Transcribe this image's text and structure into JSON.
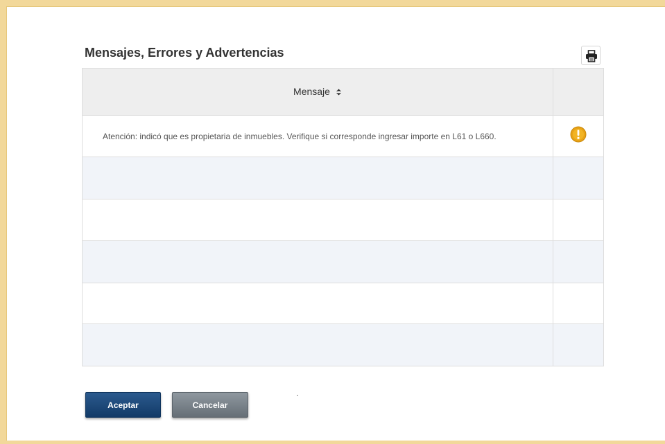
{
  "dialog": {
    "title": "Mensajes, Errores y Advertencias",
    "print_icon": "printer-icon"
  },
  "table": {
    "columns": [
      {
        "label": "Mensaje",
        "sort_icon": "sort-toggle-icon"
      },
      {
        "label": ""
      }
    ],
    "rows": [
      {
        "message": "Atención: indicó que es propietaria de inmuebles. Verifique si corresponde ingresar importe en L61 o L660.",
        "status_icon": "warning-icon"
      },
      {
        "message": "",
        "status_icon": ""
      },
      {
        "message": "",
        "status_icon": ""
      },
      {
        "message": "",
        "status_icon": ""
      },
      {
        "message": "",
        "status_icon": ""
      },
      {
        "message": "",
        "status_icon": ""
      }
    ]
  },
  "buttons": {
    "accept_label": "Aceptar",
    "cancel_label": "Cancelar"
  },
  "colors": {
    "frame": "#f2d89a",
    "accept": "#1d4a7a",
    "cancel": "#79828a",
    "warning": "#e8a317"
  }
}
